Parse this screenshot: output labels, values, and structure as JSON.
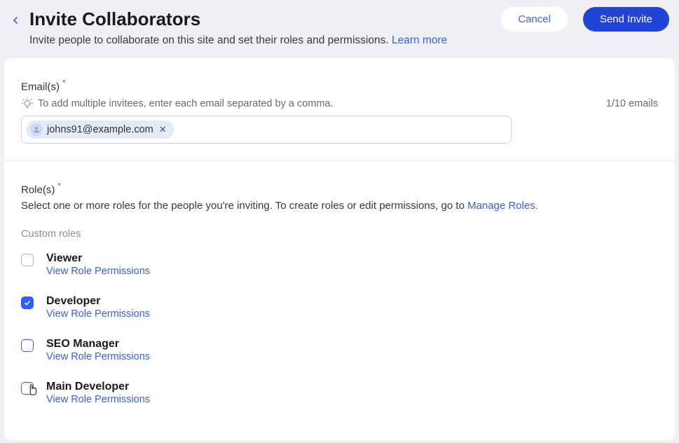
{
  "header": {
    "title": "Invite Collaborators",
    "subtitle_prefix": "Invite people to collaborate on this site and set their roles and permissions. ",
    "learn_more": "Learn more",
    "cancel": "Cancel",
    "send_invite": "Send Invite"
  },
  "emails": {
    "label": "Email(s)",
    "hint": "To add multiple invitees, enter each email separated by a comma.",
    "counter": "1/10 emails",
    "chips": [
      {
        "email": "johns91@example.com"
      }
    ]
  },
  "roles": {
    "label": "Role(s)",
    "description_prefix": "Select one or more roles for the people you're inviting. To create roles or edit permissions, go to ",
    "manage_link": "Manage Roles.",
    "section_label": "Custom roles",
    "items": [
      {
        "name": "Viewer",
        "link": "View Role Permissions",
        "checked": false,
        "blue_border": false
      },
      {
        "name": "Developer",
        "link": "View Role Permissions",
        "checked": true,
        "blue_border": true
      },
      {
        "name": "SEO Manager",
        "link": "View Role Permissions",
        "checked": false,
        "blue_border": true
      },
      {
        "name": "Main Developer",
        "link": "View Role Permissions",
        "checked": false,
        "blue_border": true
      }
    ]
  }
}
